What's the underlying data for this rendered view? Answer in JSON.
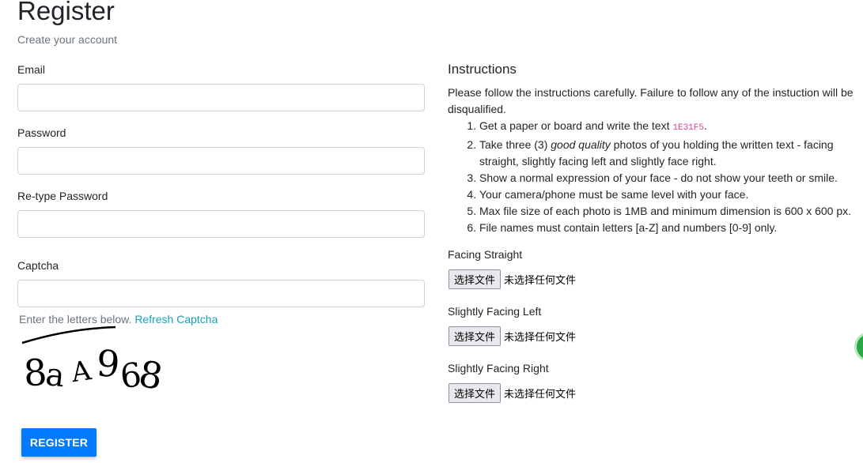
{
  "header": {
    "title": "Register",
    "subtitle": "Create your account"
  },
  "form": {
    "email_label": "Email",
    "email_value": "",
    "password_label": "Password",
    "password_value": "",
    "retype_label": "Re-type Password",
    "retype_value": "",
    "captcha_label": "Captcha",
    "captcha_value": "",
    "captcha_help": "Enter the letters below.",
    "refresh_link": "Refresh Captcha",
    "captcha_text": "8aA968",
    "register_button": "REGISTER"
  },
  "instructions": {
    "title": "Instructions",
    "intro": "Please follow the instructions carefully. Failure to follow any of the instuction will be disqualified.",
    "item1_prefix": "Get a paper or board and write the text ",
    "item1_code": "1E31F5",
    "item1_suffix": ".",
    "item2_prefix": "Take three (3) ",
    "item2_emph": "good quality",
    "item2_suffix": " photos of you holding the written text - facing straight, slightly facing left and slightly face right.",
    "item3": "Show a normal expression of your face - do not show your teeth or smile.",
    "item4": "Your camera/phone must be same level with your face.",
    "item5": "Max file size of each photo is 1MB and minimum dimension is 600 x 600 px.",
    "item6": "File names must contain letters [a-Z] and numbers [0-9] only."
  },
  "uploads": {
    "straight_label": "Facing Straight",
    "left_label": "Slightly Facing Left",
    "right_label": "Slightly Facing Right",
    "choose_button": "选择文件",
    "no_file_text": "未选择任何文件"
  },
  "colors": {
    "primary": "#007bff",
    "link": "#17a2b8",
    "code": "#e83e8c",
    "muted": "#6c757d"
  }
}
